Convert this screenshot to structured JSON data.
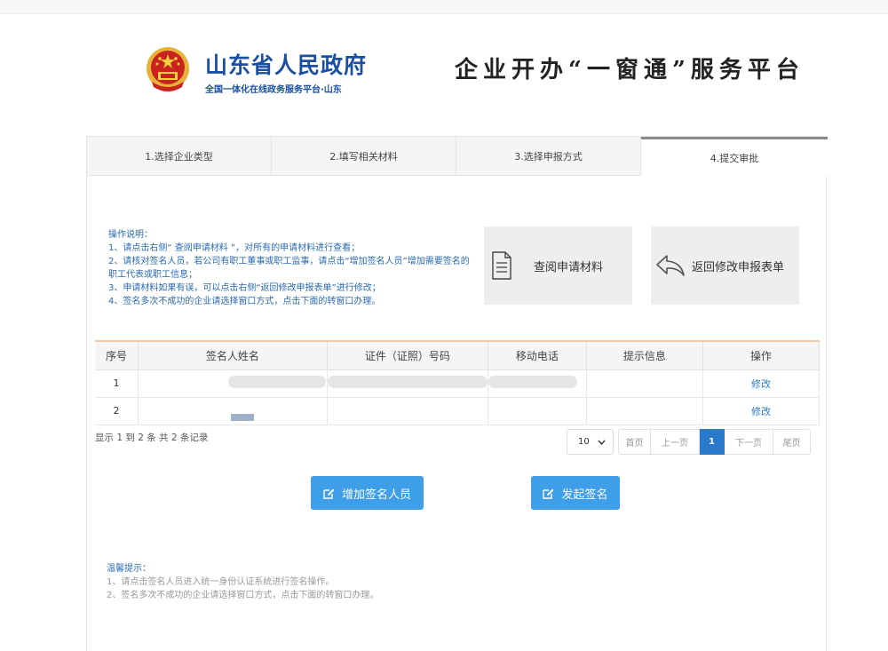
{
  "header": {
    "gov_name": "山东省人民政府",
    "gov_sub": "全国一体化在线政务服务平台·山东",
    "platform_title": "企业开办“一窗通”服务平台"
  },
  "tabs": [
    {
      "label": "1.选择企业类型"
    },
    {
      "label": "2.填写相关材料"
    },
    {
      "label": "3.选择申报方式"
    },
    {
      "label": "4.提交审批"
    }
  ],
  "instructions": {
    "head": "操作说明：",
    "lines": [
      "1、请点击右侧“ 查阅申请材料 ”，对所有的申请材料进行查看；",
      "2、请核对签名人员，若公司有职工董事或职工监事，请点击“增加签名人员”增加需要签名的职工代表或职工信息；",
      "3、申请材料如果有误，可以点击右侧“返回修改申报表单”进行修改；",
      "4、签名多次不成功的企业请选择窗口方式，点击下面的转窗口办理。"
    ]
  },
  "actions": {
    "view": "查阅申请材料",
    "back": "返回修改申报表单"
  },
  "table": {
    "headers": [
      "序号",
      "签名人姓名",
      "证件（证照）号码",
      "移动电话",
      "提示信息",
      "操作"
    ],
    "rows": [
      {
        "no": "1",
        "action": "修改"
      },
      {
        "no": "2",
        "action": "修改"
      }
    ]
  },
  "record_info": "显示 1 到 2 条 共 2 条记录",
  "pager": {
    "page_size": "10",
    "first": "首页",
    "prev": "上一页",
    "current": "1",
    "next": "下一页",
    "last": "尾页"
  },
  "buttons": {
    "add_signer": "增加签名人员",
    "start_sign": "发起签名"
  },
  "tips": {
    "head": "温馨提示：",
    "lines": [
      "1、请点击签名人员进入统一身份认证系统进行签名操作。",
      "2、签名多次不成功的企业请选择窗口方式，点击下面的转窗口办理。"
    ]
  },
  "colors": {
    "brand_blue": "#1a4fa3",
    "button_blue": "#3e9ee8",
    "link_blue": "#2a7ac9"
  }
}
